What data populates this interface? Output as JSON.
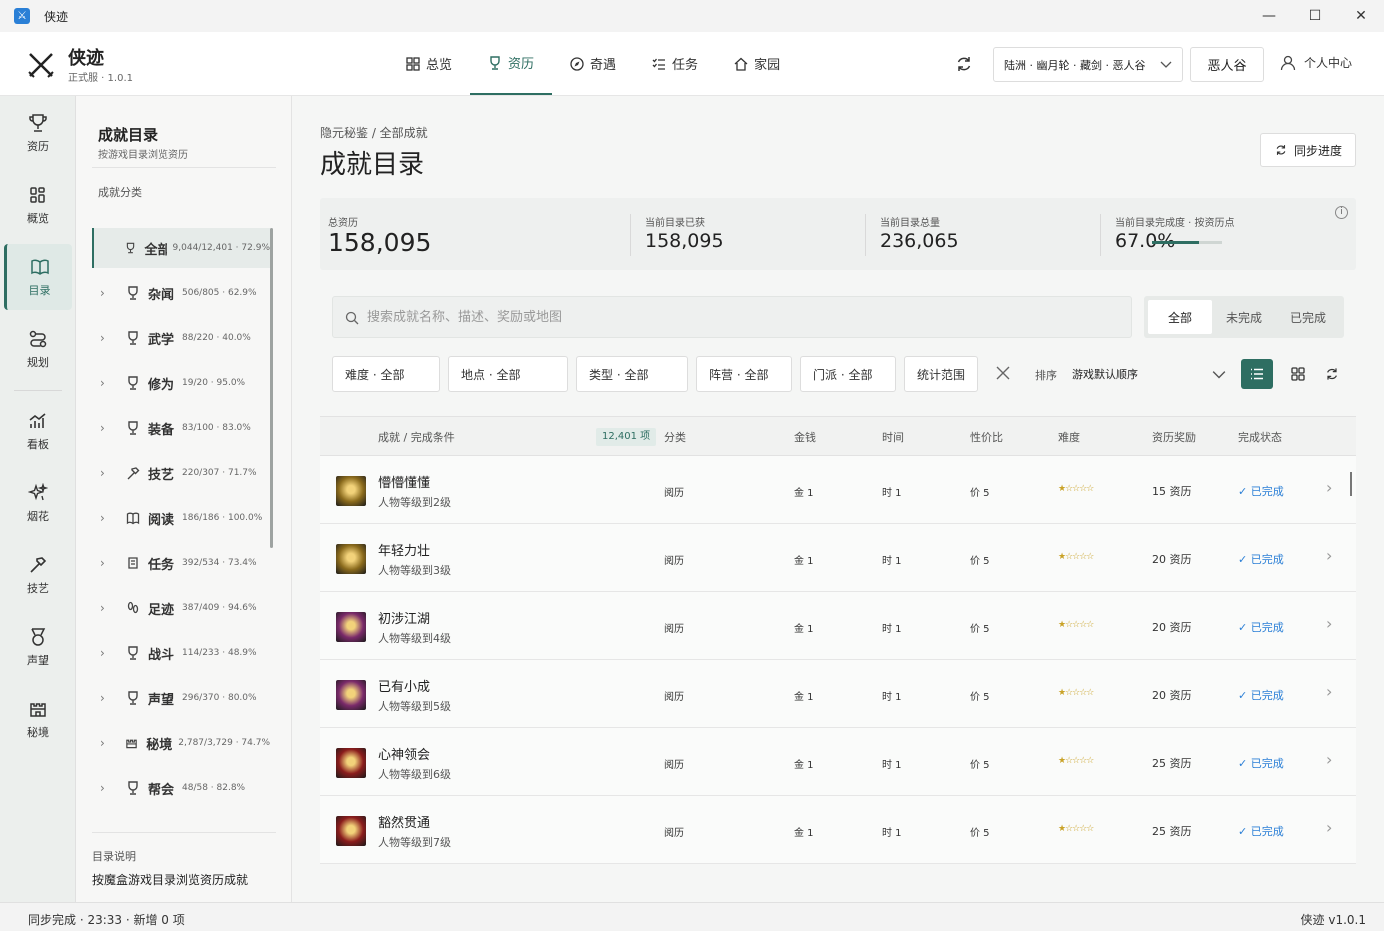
{
  "window": {
    "title": "侠迹"
  },
  "header": {
    "brand": "侠迹",
    "version": "正式服 · 1.0.1",
    "nav": [
      {
        "label": "总览",
        "icon": "grid-icon"
      },
      {
        "label": "资历",
        "icon": "trophy-icon",
        "active": true
      },
      {
        "label": "奇遇",
        "icon": "compass-icon"
      },
      {
        "label": "任务",
        "icon": "checklist-icon"
      },
      {
        "label": "家园",
        "icon": "home-icon"
      }
    ],
    "server": "陆洲 · 幽月轮 · 藏剑 · 恶人谷",
    "camp": "恶人谷",
    "profile": "个人中心"
  },
  "rail": [
    {
      "label": "资历",
      "icon": "trophy-icon"
    },
    {
      "label": "概览",
      "icon": "grid-icon"
    },
    {
      "label": "目录",
      "icon": "book-icon",
      "active": true
    },
    {
      "label": "规划",
      "icon": "route-icon"
    },
    {
      "label": "看板",
      "icon": "chart-icon"
    },
    {
      "label": "烟花",
      "icon": "firework-icon"
    },
    {
      "label": "技艺",
      "icon": "hammer-icon"
    },
    {
      "label": "声望",
      "icon": "medal-icon"
    },
    {
      "label": "秘境",
      "icon": "castle-icon"
    }
  ],
  "catpanel": {
    "title": "成就目录",
    "subtitle": "按游戏目录浏览资历",
    "section": "成就分类",
    "items": [
      {
        "name": "全部",
        "stat": "9,044/12,401 · 72.9%",
        "icon": "trophy-icon",
        "active": true
      },
      {
        "name": "杂闻",
        "stat": "506/805 · 62.9%",
        "icon": "trophy-icon"
      },
      {
        "name": "武学",
        "stat": "88/220 · 40.0%",
        "icon": "trophy-icon"
      },
      {
        "name": "修为",
        "stat": "19/20 · 95.0%",
        "icon": "trophy-icon"
      },
      {
        "name": "装备",
        "stat": "83/100 · 83.0%",
        "icon": "trophy-icon"
      },
      {
        "name": "技艺",
        "stat": "220/307 · 71.7%",
        "icon": "hammer-icon"
      },
      {
        "name": "阅读",
        "stat": "186/186 · 100.0%",
        "icon": "book-icon"
      },
      {
        "name": "任务",
        "stat": "392/534 · 73.4%",
        "icon": "scroll-icon"
      },
      {
        "name": "足迹",
        "stat": "387/409 · 94.6%",
        "icon": "footprint-icon"
      },
      {
        "name": "战斗",
        "stat": "114/233 · 48.9%",
        "icon": "trophy-icon"
      },
      {
        "name": "声望",
        "stat": "296/370 · 80.0%",
        "icon": "trophy-icon"
      },
      {
        "name": "秘境",
        "stat": "2,787/3,729 · 74.7%",
        "icon": "castle-icon"
      },
      {
        "name": "帮会",
        "stat": "48/58 · 82.8%",
        "icon": "trophy-icon"
      }
    ],
    "desc_title": "目录说明",
    "desc": "按魔盒游戏目录浏览资历成就"
  },
  "main": {
    "breadcrumb": "隐元秘鉴 / 全部成就",
    "title": "成就目录",
    "sync_label": "同步进度",
    "stats": [
      {
        "label": "总资历",
        "value": "158,095"
      },
      {
        "label": "当前目录已获",
        "value": "158,095"
      },
      {
        "label": "当前目录总量",
        "value": "236,065"
      },
      {
        "label": "当前目录完成度 · 按资历点",
        "value": "67.0%",
        "progress": 0.67
      }
    ],
    "search_placeholder": "搜索成就名称、描述、奖励或地图",
    "segments": [
      {
        "label": "全部",
        "active": true
      },
      {
        "label": "未完成"
      },
      {
        "label": "已完成"
      }
    ],
    "filters": [
      "难度 · 全部",
      "地点 · 全部",
      "类型 · 全部",
      "阵营 · 全部",
      "门派 · 全部",
      "统计范围"
    ],
    "sort_label": "排序",
    "sort_value": "游戏默认顺序"
  },
  "table": {
    "headers": {
      "name": "成就 / 完成条件",
      "category": "分类",
      "money": "金钱",
      "time": "时间",
      "value": "性价比",
      "difficulty": "难度",
      "reward": "资历奖励",
      "status": "完成状态"
    },
    "count": "12,401 项",
    "rows": [
      {
        "name": "懵懵懂懂",
        "cond": "人物等级到2级",
        "category": "阅历",
        "money": "金 1",
        "time": "时 1",
        "value": "价 5",
        "stars": "★☆☆☆☆",
        "reward": "15 资历",
        "status": "✓ 已完成",
        "thumb": "#8a6a1c"
      },
      {
        "name": "年轻力壮",
        "cond": "人物等级到3级",
        "category": "阅历",
        "money": "金 1",
        "time": "时 1",
        "value": "价 5",
        "stars": "★☆☆☆☆",
        "reward": "20 资历",
        "status": "✓ 已完成",
        "thumb": "#8a6a1c"
      },
      {
        "name": "初涉江湖",
        "cond": "人物等级到4级",
        "category": "阅历",
        "money": "金 1",
        "time": "时 1",
        "value": "价 5",
        "stars": "★☆☆☆☆",
        "reward": "20 资历",
        "status": "✓ 已完成",
        "thumb": "#7a2a6a"
      },
      {
        "name": "已有小成",
        "cond": "人物等级到5级",
        "category": "阅历",
        "money": "金 1",
        "time": "时 1",
        "value": "价 5",
        "stars": "★☆☆☆☆",
        "reward": "20 资历",
        "status": "✓ 已完成",
        "thumb": "#7a2a6a"
      },
      {
        "name": "心神领会",
        "cond": "人物等级到6级",
        "category": "阅历",
        "money": "金 1",
        "time": "时 1",
        "value": "价 5",
        "stars": "★☆☆☆☆",
        "reward": "25 资历",
        "status": "✓ 已完成",
        "thumb": "#8a1c1c"
      },
      {
        "name": "豁然贯通",
        "cond": "人物等级到7级",
        "category": "阅历",
        "money": "金 1",
        "time": "时 1",
        "value": "价 5",
        "stars": "★☆☆☆☆",
        "reward": "25 资历",
        "status": "✓ 已完成",
        "thumb": "#8a1c1c"
      }
    ]
  },
  "status": {
    "left": "同步完成 · 23:33 · 新增 0 项",
    "right": "侠迹 v1.0.1"
  }
}
